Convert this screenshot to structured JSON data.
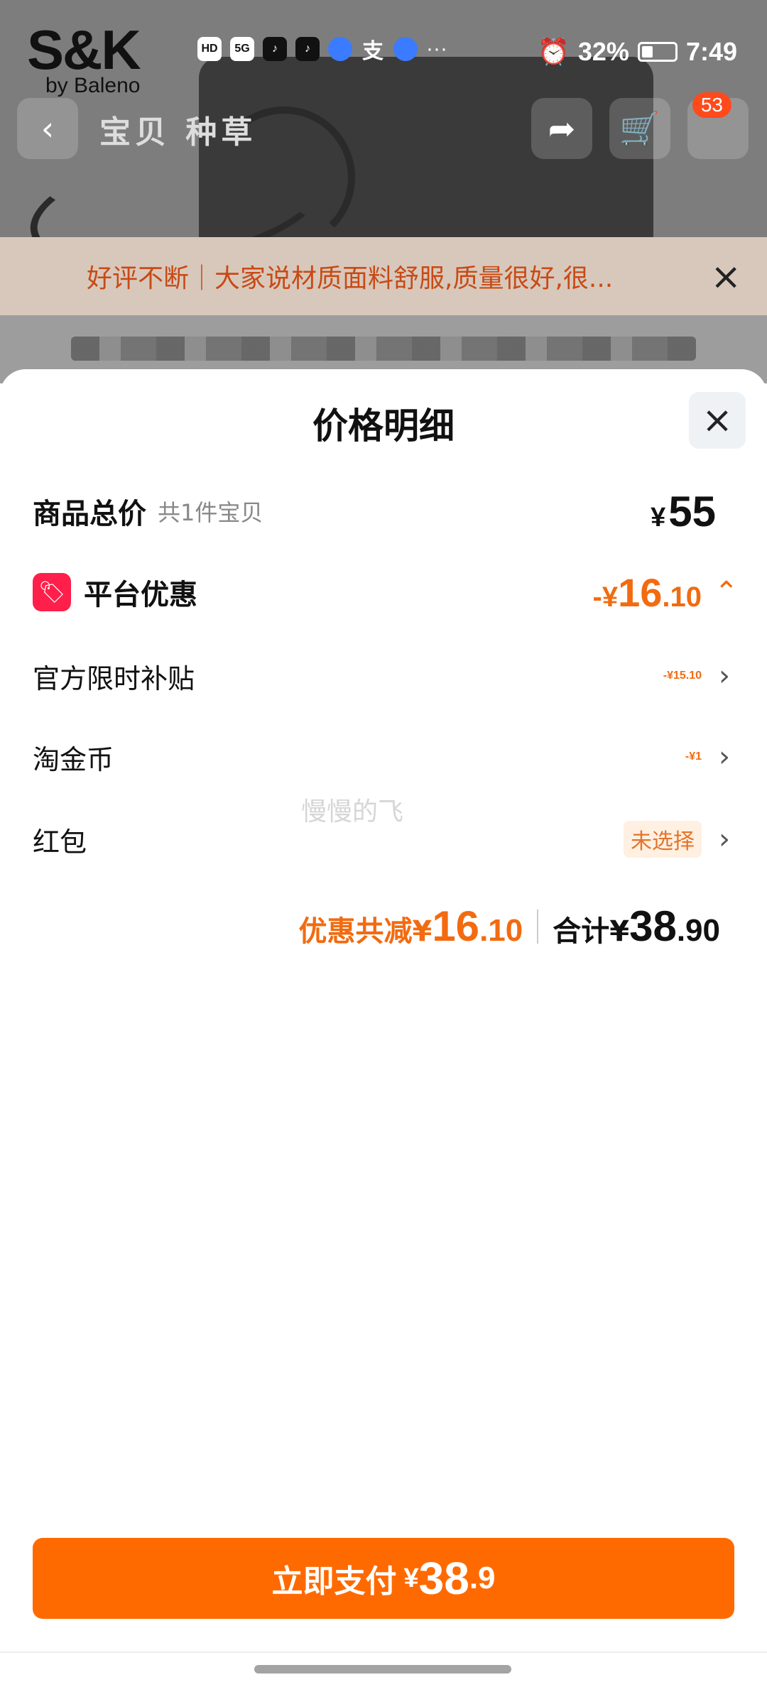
{
  "background": {
    "logo": {
      "main": "S&K",
      "sub": "by Baleno"
    },
    "status_bar": {
      "network_hd": "HD",
      "network_5g": "5G",
      "more": "···",
      "battery": "32%",
      "time": "7:49",
      "icons": [
        "hd-icon",
        "signal-5g-icon",
        "tiktok-icon",
        "tiktok-lite-icon",
        "browser-icon",
        "alipay-icon",
        "browser-icon",
        "alarm-icon",
        "battery-icon"
      ]
    },
    "nav": {
      "back": "‹",
      "tabs": "宝贝 种草",
      "cart_badge": "53"
    },
    "review_banner": {
      "text": "好评不断｜大家说材质面料舒服,质量很好,很...",
      "close": "×"
    }
  },
  "sheet": {
    "title": "价格明细",
    "close": "×",
    "rows": {
      "total": {
        "label": "商品总价",
        "sub": "共1件宝贝",
        "currency": "¥",
        "amount": "55"
      },
      "platform": {
        "label": "平台优惠",
        "prefix": "-¥",
        "int": "16",
        "dec": ".10"
      },
      "subsidy": {
        "label": "官方限时补贴",
        "value": "-¥15.10"
      },
      "coins": {
        "label": "淘金币",
        "value": "-¥1"
      },
      "redpacket": {
        "label": "红包",
        "value": "未选择"
      }
    },
    "watermark": "慢慢的飞",
    "summary": {
      "discount_label": "优惠共减¥",
      "discount_int": "16",
      "discount_dec": ".10",
      "total_label": "合计¥",
      "total_int": "38",
      "total_dec": ".90"
    },
    "pay_button": {
      "label": "立即支付",
      "currency": "¥",
      "int": "38",
      "dec": ".9"
    }
  },
  "colors": {
    "accent": "#ff6a00",
    "discount_text": "#f26b10",
    "tag_red": "#ff1f4b"
  }
}
